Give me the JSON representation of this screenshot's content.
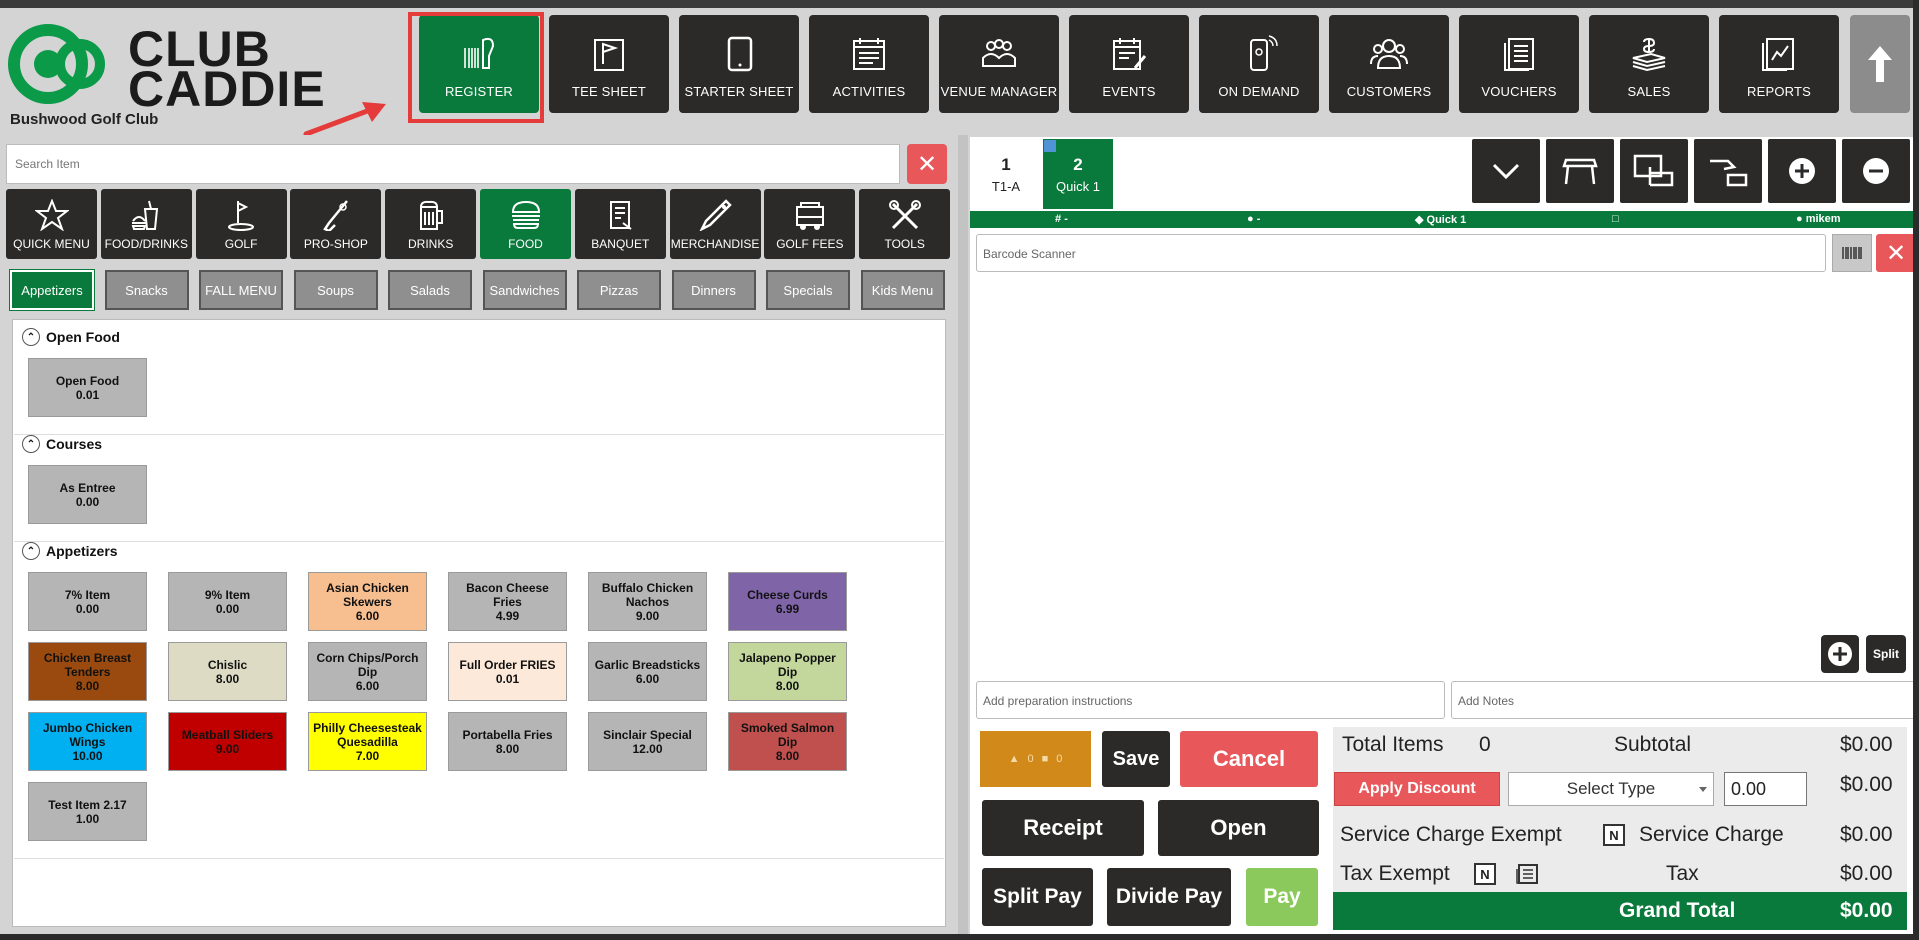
{
  "brand": {
    "logo_line1": "CLUB",
    "logo_line2": "CADDIE",
    "club_name": "Bushwood Golf Club",
    "accent": "#0a7a3c",
    "dark": "#2b2a28",
    "danger": "#e8585b"
  },
  "nav": [
    {
      "label": "REGISTER",
      "icon": "barcode-scanner-icon",
      "active": true
    },
    {
      "label": "TEE SHEET",
      "icon": "flag-icon"
    },
    {
      "label": "STARTER SHEET",
      "icon": "tablet-icon"
    },
    {
      "label": "ACTIVITIES",
      "icon": "calendar-list-icon"
    },
    {
      "label": "VENUE MANAGER",
      "icon": "meeting-icon"
    },
    {
      "label": "EVENTS",
      "icon": "calendar-edit-icon"
    },
    {
      "label": "ON DEMAND",
      "icon": "phone-icon"
    },
    {
      "label": "CUSTOMERS",
      "icon": "people-icon"
    },
    {
      "label": "VOUCHERS",
      "icon": "voucher-icon"
    },
    {
      "label": "SALES",
      "icon": "money-icon"
    },
    {
      "label": "REPORTS",
      "icon": "report-icon"
    }
  ],
  "search": {
    "placeholder": "Search Item",
    "clear": "✕"
  },
  "categories": [
    {
      "label": "QUICK MENU",
      "icon": "star-icon"
    },
    {
      "label": "FOOD/DRINKS",
      "icon": "food-drink-icon"
    },
    {
      "label": "GOLF",
      "icon": "golf-icon"
    },
    {
      "label": "PRO-SHOP",
      "icon": "club-icon"
    },
    {
      "label": "DRINKS",
      "icon": "beer-icon"
    },
    {
      "label": "FOOD",
      "icon": "burger-icon",
      "active": true
    },
    {
      "label": "BANQUET",
      "icon": "banquet-icon"
    },
    {
      "label": "MERCHANDISE",
      "icon": "tag-icon"
    },
    {
      "label": "GOLF FEES",
      "icon": "cart-icon"
    },
    {
      "label": "TOOLS",
      "icon": "tools-icon"
    }
  ],
  "subcategories": [
    "Appetizers",
    "Snacks",
    "FALL MENU",
    "Soups",
    "Salads",
    "Sandwiches",
    "Pizzas",
    "Dinners",
    "Specials",
    "Kids Menu"
  ],
  "sections": [
    {
      "title": "Open Food",
      "items": [
        {
          "name": "Open Food",
          "price": "0.01",
          "color": "#b5b5b5"
        }
      ]
    },
    {
      "title": "Courses",
      "items": [
        {
          "name": "As Entree",
          "price": "0.00",
          "color": "#b5b5b5"
        }
      ]
    },
    {
      "title": "Appetizers",
      "items": [
        {
          "name": "7% Item",
          "price": "0.00",
          "color": "#b5b5b5"
        },
        {
          "name": "9% Item",
          "price": "0.00",
          "color": "#b5b5b5"
        },
        {
          "name": "Asian Chicken Skewers",
          "price": "6.00",
          "color": "#f7bf90"
        },
        {
          "name": "Bacon Cheese Fries",
          "price": "4.99",
          "color": "#b5b5b5"
        },
        {
          "name": "Buffalo Chicken Nachos",
          "price": "9.00",
          "color": "#b5b5b5"
        },
        {
          "name": "Cheese Curds",
          "price": "6.99",
          "color": "#8064a8"
        },
        {
          "name": "Chicken Breast Tenders",
          "price": "8.00",
          "color": "#9a4a0e"
        },
        {
          "name": "Chislic",
          "price": "8.00",
          "color": "#dddbc4"
        },
        {
          "name": "Corn Chips/Porch Dip",
          "price": "6.00",
          "color": "#b5b5b5"
        },
        {
          "name": "Full Order FRIES",
          "price": "0.01",
          "color": "#fde9d9"
        },
        {
          "name": "Garlic Breadsticks",
          "price": "6.00",
          "color": "#b5b5b5"
        },
        {
          "name": "Jalapeno Popper Dip",
          "price": "8.00",
          "color": "#c3d69b"
        },
        {
          "name": "Jumbo Chicken Wings",
          "price": "10.00",
          "color": "#00b0f0"
        },
        {
          "name": "Meatball Sliders",
          "price": "9.00",
          "color": "#c00000"
        },
        {
          "name": "Philly Cheesesteak Quesadilla",
          "price": "7.00",
          "color": "#ffff00"
        },
        {
          "name": "Portabella Fries",
          "price": "8.00",
          "color": "#b5b5b5"
        },
        {
          "name": "Sinclair Special",
          "price": "12.00",
          "color": "#b5b5b5"
        },
        {
          "name": "Smoked Salmon Dip",
          "price": "8.00",
          "color": "#c0504d"
        },
        {
          "name": "Test Item 2.17",
          "price": "1.00",
          "color": "#b5b5b5"
        }
      ]
    }
  ],
  "tickets": [
    {
      "num": "1",
      "label": "T1-A"
    },
    {
      "num": "2",
      "label": "Quick 1"
    }
  ],
  "info": {
    "table": "-",
    "customer": "-",
    "ticket": "Quick 1",
    "seat": "",
    "user": "mikem"
  },
  "barcode": {
    "placeholder": "Barcode Scanner",
    "clear": "✕"
  },
  "split_label": "Split",
  "prep_placeholder": "Add preparation instructions",
  "notes_placeholder": "Add Notes",
  "tracker": {
    "a": "0",
    "b": "0"
  },
  "actions": {
    "save": "Save",
    "cancel": "Cancel",
    "receipt": "Receipt",
    "open": "Open",
    "split_pay": "Split Pay",
    "divide_pay": "Divide Pay",
    "pay": "Pay"
  },
  "totals": {
    "total_items_label": "Total Items",
    "total_items": "0",
    "subtotal_label": "Subtotal",
    "subtotal": "$0.00",
    "apply_discount": "Apply Discount",
    "select_type": "Select Type",
    "discount_value": "0.00",
    "discount_total": "$0.00",
    "svc_exempt_label": "Service Charge Exempt",
    "svc_exempt_flag": "N",
    "svc_label": "Service Charge",
    "svc": "$0.00",
    "tax_exempt_label": "Tax Exempt",
    "tax_exempt_flag": "N",
    "tax_label": "Tax",
    "tax": "$0.00",
    "grand_label": "Grand Total",
    "grand": "$0.00"
  }
}
